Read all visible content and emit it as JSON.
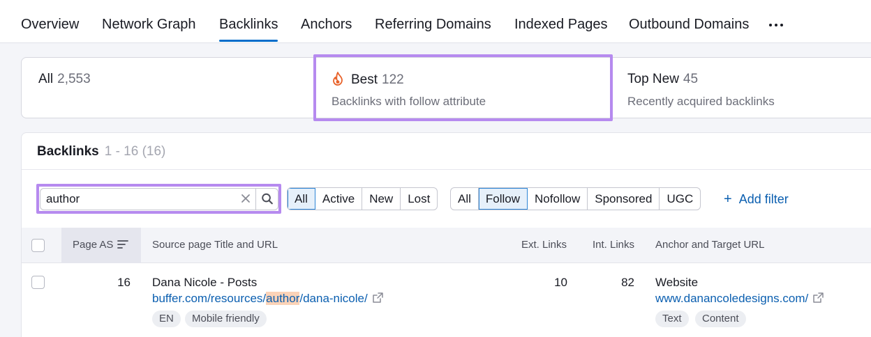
{
  "tabs": [
    "Overview",
    "Network Graph",
    "Backlinks",
    "Anchors",
    "Referring Domains",
    "Indexed Pages",
    "Outbound Domains"
  ],
  "active_tab": "Backlinks",
  "cards": {
    "all": {
      "label": "All",
      "count": "2,553"
    },
    "best": {
      "label": "Best",
      "count": "122",
      "subtitle": "Backlinks with follow attribute",
      "icon": "fire-icon"
    },
    "top_new": {
      "label": "Top New",
      "count": "45",
      "subtitle": "Recently acquired backlinks"
    }
  },
  "panel": {
    "title": "Backlinks",
    "range": "1 - 16 (16)"
  },
  "search": {
    "value": "author"
  },
  "status_filter": {
    "options": [
      "All",
      "Active",
      "New",
      "Lost"
    ],
    "selected": "All"
  },
  "type_filter": {
    "options": [
      "All",
      "Follow",
      "Nofollow",
      "Sponsored",
      "UGC"
    ],
    "selected": "Follow"
  },
  "add_filter_label": "Add filter",
  "columns": {
    "page_as": "Page AS",
    "source": "Source page Title and URL",
    "ext_links": "Ext. Links",
    "int_links": "Int. Links",
    "anchor": "Anchor and Target URL"
  },
  "rows": [
    {
      "page_as": "16",
      "title": "Dana Nicole - Posts",
      "url_prefix": "buffer.com/resources/",
      "url_highlight": "author",
      "url_suffix": "/dana-nicole/",
      "tags": [
        "EN",
        "Mobile friendly"
      ],
      "ext_links": "10",
      "int_links": "82",
      "anchor_text": "Website",
      "target_url": "www.danancoledesigns.com/",
      "anchor_tags": [
        "Text",
        "Content"
      ]
    }
  ],
  "colors": {
    "accent": "#006dca",
    "highlight_box": "#b68aef",
    "link": "#0b5fb0",
    "search_highlight": "#fbd3b8"
  }
}
